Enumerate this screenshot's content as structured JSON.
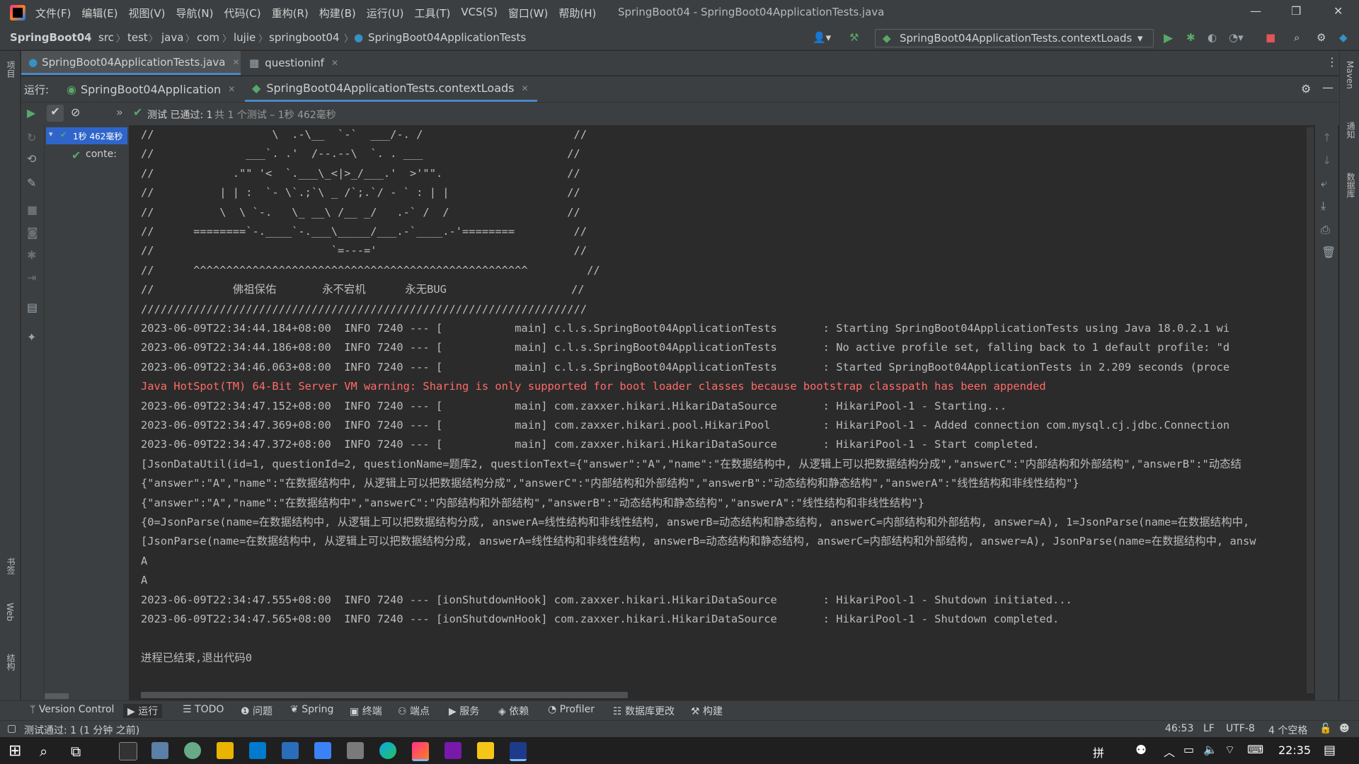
{
  "app": {
    "menu": [
      "文件(F)",
      "编辑(E)",
      "视图(V)",
      "导航(N)",
      "代码(C)",
      "重构(R)",
      "构建(B)",
      "运行(U)",
      "工具(T)",
      "VCS(S)",
      "窗口(W)",
      "帮助(H)"
    ],
    "window_title": "SpringBoot04 - SpringBoot04ApplicationTests.java"
  },
  "breadcrumb": [
    "SpringBoot04",
    "src",
    "test",
    "java",
    "com",
    "lujie",
    "springboot04",
    "SpringBoot04ApplicationTests"
  ],
  "run_config": "SpringBoot04ApplicationTests.contextLoads",
  "editor_tabs": [
    {
      "label": "SpringBoot04ApplicationTests.java"
    },
    {
      "label": "questioninf"
    }
  ],
  "run_window": {
    "label": "运行:",
    "tabs": [
      {
        "label": "SpringBoot04Application"
      },
      {
        "label": "SpringBoot04ApplicationTests.contextLoads"
      }
    ],
    "status_prefix": "测试 已通过: 1",
    "status_detail": "共 1 个测试 – 1秒 462毫秒",
    "tree_root": "1秒 462毫秒",
    "tree_child": "conte:"
  },
  "console_lines": [
    {
      "text": "//                  \\  .-\\__  `-`  ___/-. /                       //",
      "error": false
    },
    {
      "text": "//              ___`. .'  /--.--\\  `. . ___                      //",
      "error": false
    },
    {
      "text": "//            .\"\" '<  `.___\\_<|>_/___.'  >'\"\".                   //",
      "error": false
    },
    {
      "text": "//          | | :  `- \\`.;`\\ _ /`;.`/ - ` : | |                  //",
      "error": false
    },
    {
      "text": "//          \\  \\ `-.   \\_ __\\ /__ _/   .-` /  /                  //",
      "error": false
    },
    {
      "text": "//      ========`-.____`-.___\\_____/___.-`____.-'========         //",
      "error": false
    },
    {
      "text": "//                           `=---='                              //",
      "error": false
    },
    {
      "text": "//      ^^^^^^^^^^^^^^^^^^^^^^^^^^^^^^^^^^^^^^^^^^^^^^^^^^^         //",
      "error": false
    },
    {
      "text": "//            佛祖保佑       永不宕机      永无BUG                   //",
      "error": false
    },
    {
      "text": "////////////////////////////////////////////////////////////////////",
      "error": false
    },
    {
      "text": "2023-06-09T22:34:44.184+08:00  INFO 7240 --- [           main] c.l.s.SpringBoot04ApplicationTests       : Starting SpringBoot04ApplicationTests using Java 18.0.2.1 wi",
      "error": false
    },
    {
      "text": "2023-06-09T22:34:44.186+08:00  INFO 7240 --- [           main] c.l.s.SpringBoot04ApplicationTests       : No active profile set, falling back to 1 default profile: \"d",
      "error": false
    },
    {
      "text": "2023-06-09T22:34:46.063+08:00  INFO 7240 --- [           main] c.l.s.SpringBoot04ApplicationTests       : Started SpringBoot04ApplicationTests in 2.209 seconds (proce",
      "error": false
    },
    {
      "text": "Java HotSpot(TM) 64-Bit Server VM warning: Sharing is only supported for boot loader classes because bootstrap classpath has been appended",
      "error": true
    },
    {
      "text": "2023-06-09T22:34:47.152+08:00  INFO 7240 --- [           main] com.zaxxer.hikari.HikariDataSource       : HikariPool-1 - Starting...",
      "error": false
    },
    {
      "text": "2023-06-09T22:34:47.369+08:00  INFO 7240 --- [           main] com.zaxxer.hikari.pool.HikariPool        : HikariPool-1 - Added connection com.mysql.cj.jdbc.Connection",
      "error": false
    },
    {
      "text": "2023-06-09T22:34:47.372+08:00  INFO 7240 --- [           main] com.zaxxer.hikari.HikariDataSource       : HikariPool-1 - Start completed.",
      "error": false
    },
    {
      "text": "[JsonDataUtil(id=1, questionId=2, questionName=题库2, questionText={\"answer\":\"A\",\"name\":\"在数据结构中, 从逻辑上可以把数据结构分成\",\"answerC\":\"内部结构和外部结构\",\"answerB\":\"动态结",
      "error": false
    },
    {
      "text": "{\"answer\":\"A\",\"name\":\"在数据结构中, 从逻辑上可以把数据结构分成\",\"answerC\":\"内部结构和外部结构\",\"answerB\":\"动态结构和静态结构\",\"answerA\":\"线性结构和非线性结构\"}",
      "error": false
    },
    {
      "text": "{\"answer\":\"A\",\"name\":\"在数据结构中\",\"answerC\":\"内部结构和外部结构\",\"answerB\":\"动态结构和静态结构\",\"answerA\":\"线性结构和非线性结构\"}",
      "error": false
    },
    {
      "text": "{0=JsonParse(name=在数据结构中, 从逻辑上可以把数据结构分成, answerA=线性结构和非线性结构, answerB=动态结构和静态结构, answerC=内部结构和外部结构, answer=A), 1=JsonParse(name=在数据结构中,",
      "error": false
    },
    {
      "text": "[JsonParse(name=在数据结构中, 从逻辑上可以把数据结构分成, answerA=线性结构和非线性结构, answerB=动态结构和静态结构, answerC=内部结构和外部结构, answer=A), JsonParse(name=在数据结构中, answ",
      "error": false
    },
    {
      "text": "A",
      "error": false
    },
    {
      "text": "A",
      "error": false
    },
    {
      "text": "2023-06-09T22:34:47.555+08:00  INFO 7240 --- [ionShutdownHook] com.zaxxer.hikari.HikariDataSource       : HikariPool-1 - Shutdown initiated...",
      "error": false
    },
    {
      "text": "2023-06-09T22:34:47.565+08:00  INFO 7240 --- [ionShutdownHook] com.zaxxer.hikari.HikariDataSource       : HikariPool-1 - Shutdown completed.",
      "error": false
    },
    {
      "text": "",
      "error": false
    },
    {
      "text": "进程已结束,退出代码0",
      "error": false
    }
  ],
  "left_stripe_labels": [
    "项目",
    "书签",
    "Web",
    "结构"
  ],
  "right_stripe_labels": [
    "Maven",
    "通知",
    "数据库"
  ],
  "bottom_tabs": [
    "Version Control",
    "运行",
    "TODO",
    "问题",
    "Spring",
    "终端",
    "端点",
    "服务",
    "依赖",
    "Profiler",
    "数据库更改",
    "构建"
  ],
  "status": {
    "message": "测试通过: 1 (1 分钟 之前)",
    "position": "46:53",
    "line_sep": "LF",
    "encoding": "UTF-8",
    "indent": "4 个空格"
  },
  "taskbar": {
    "ime": "拼",
    "time": "22:35"
  },
  "colors": {
    "error_text": "#ff6b68",
    "success_green": "#59a869",
    "accent_blue": "#3592c4"
  }
}
